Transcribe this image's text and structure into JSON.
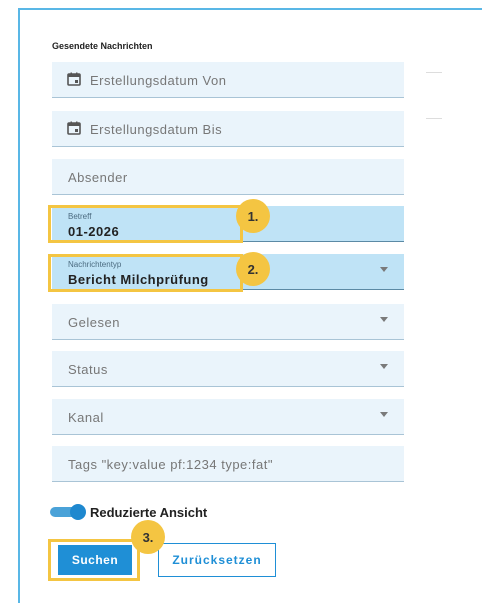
{
  "section": {
    "title": "Gesendete Nachrichten"
  },
  "fields": {
    "created_from": {
      "placeholder": "Erstellungsdatum Von"
    },
    "created_to": {
      "placeholder": "Erstellungsdatum Bis"
    },
    "sender": {
      "placeholder": "Absender"
    },
    "subject": {
      "label": "Betreff",
      "value": "01-2026"
    },
    "message_type": {
      "label": "Nachrichtentyp",
      "value": "Bericht Milchprüfung"
    },
    "read": {
      "placeholder": "Gelesen"
    },
    "status": {
      "placeholder": "Status"
    },
    "channel": {
      "placeholder": "Kanal"
    },
    "tags": {
      "placeholder": "Tags \"key:value pf:1234 type:fat\""
    }
  },
  "toggle": {
    "label": "Reduzierte Ansicht",
    "on": true
  },
  "buttons": {
    "search": "Suchen",
    "reset": "Zurücksetzen"
  },
  "annotations": {
    "step1": "1.",
    "step2": "2.",
    "step3": "3."
  },
  "colors": {
    "accent": "#1f8fd6",
    "highlight": "#f4c542",
    "field_bg": "#eaf4fb",
    "field_filled_bg": "#bfe3f6"
  },
  "icons": {
    "date": "calendar-icon",
    "dropdown": "chevron-down-icon"
  }
}
